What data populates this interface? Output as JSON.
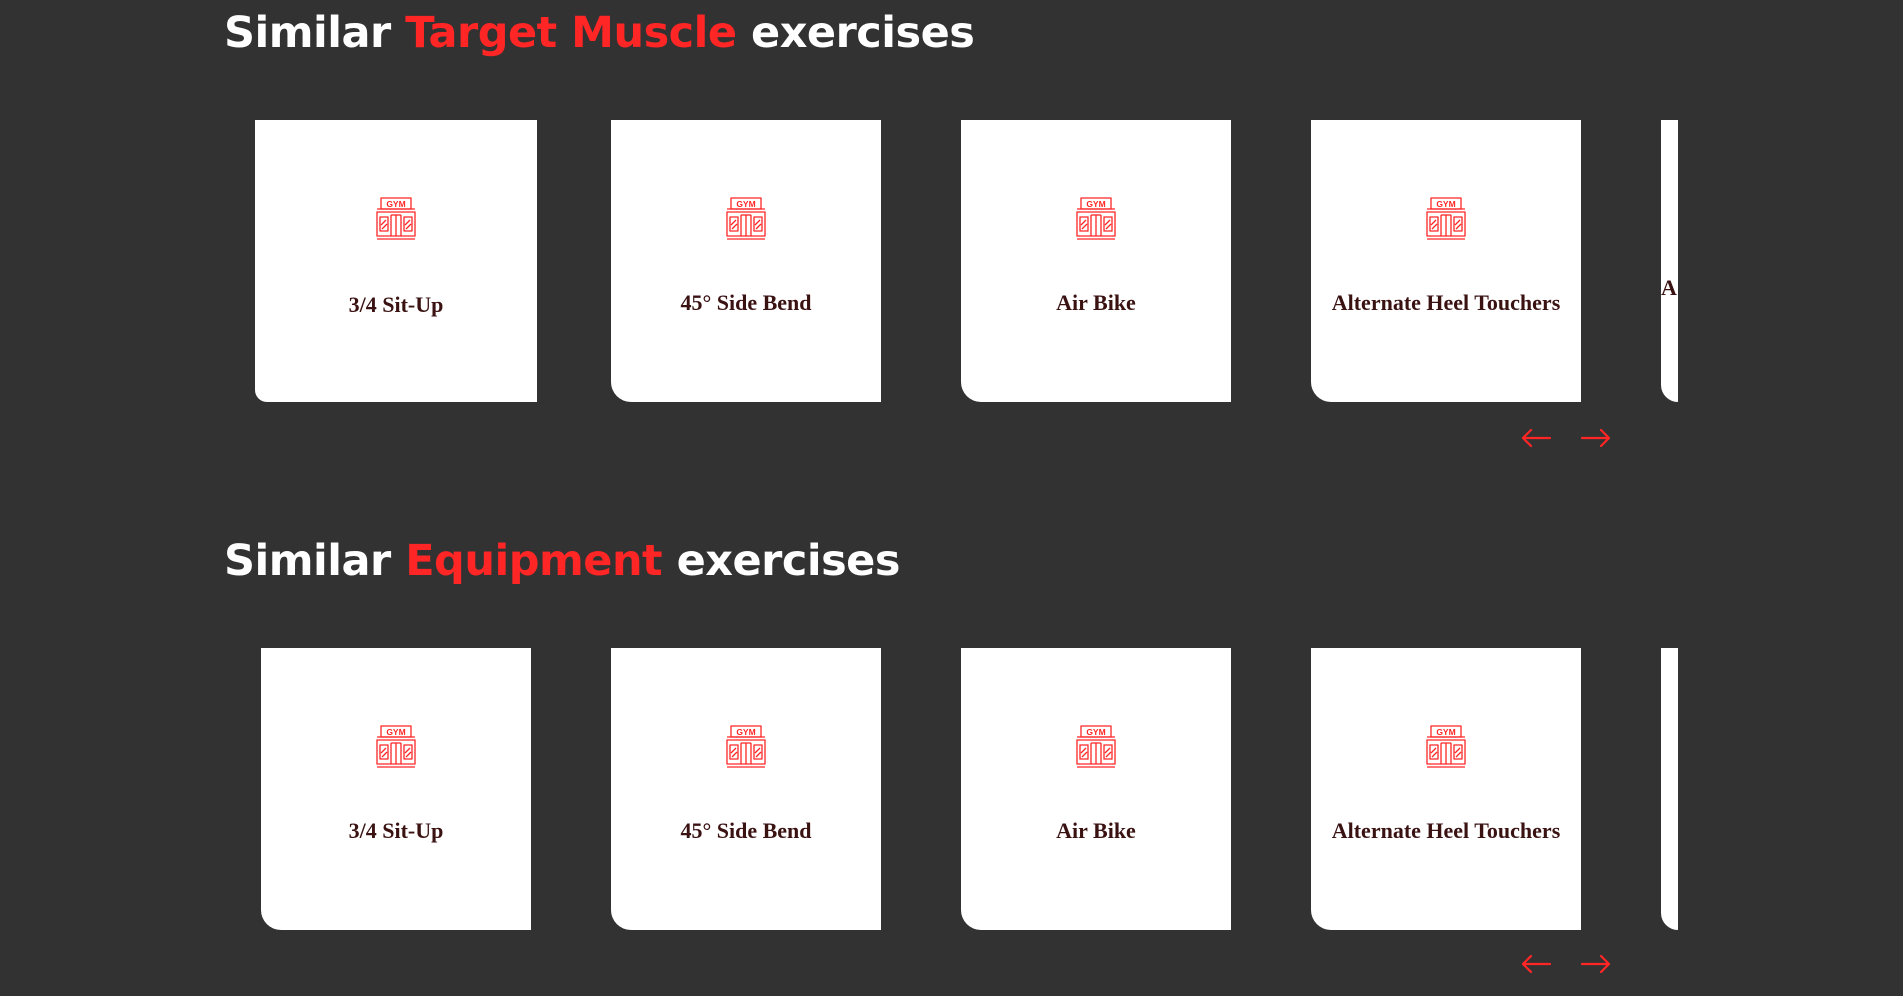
{
  "sections": [
    {
      "title_prefix": "Similar ",
      "title_accent": "Target Muscle",
      "title_suffix": " exercises",
      "cards": [
        {
          "label": "3/4 Sit-Up",
          "icon": "gym-icon"
        },
        {
          "label": "45° Side Bend",
          "icon": "gym-icon"
        },
        {
          "label": "Air Bike",
          "icon": "gym-icon"
        },
        {
          "label": "Alternate Heel Touchers",
          "icon": "gym-icon"
        },
        {
          "label": "A R",
          "icon": "gym-icon"
        }
      ],
      "nav": {
        "prev_icon": "arrow-left-icon",
        "next_icon": "arrow-right-icon"
      }
    },
    {
      "title_prefix": "Similar ",
      "title_accent": "Equipment",
      "title_suffix": " exercises",
      "cards": [
        {
          "label": "3/4 Sit-Up",
          "icon": "gym-icon"
        },
        {
          "label": "45° Side Bend",
          "icon": "gym-icon"
        },
        {
          "label": "Air Bike",
          "icon": "gym-icon"
        },
        {
          "label": "Alternate Heel Touchers",
          "icon": "gym-icon"
        },
        {
          "label": "",
          "icon": "gym-icon"
        }
      ],
      "nav": {
        "prev_icon": "arrow-left-icon",
        "next_icon": "arrow-right-icon"
      }
    }
  ],
  "colors": {
    "background": "#323232",
    "accent": "#ff2625",
    "card": "#ffffff",
    "card_text": "#3a1212"
  }
}
